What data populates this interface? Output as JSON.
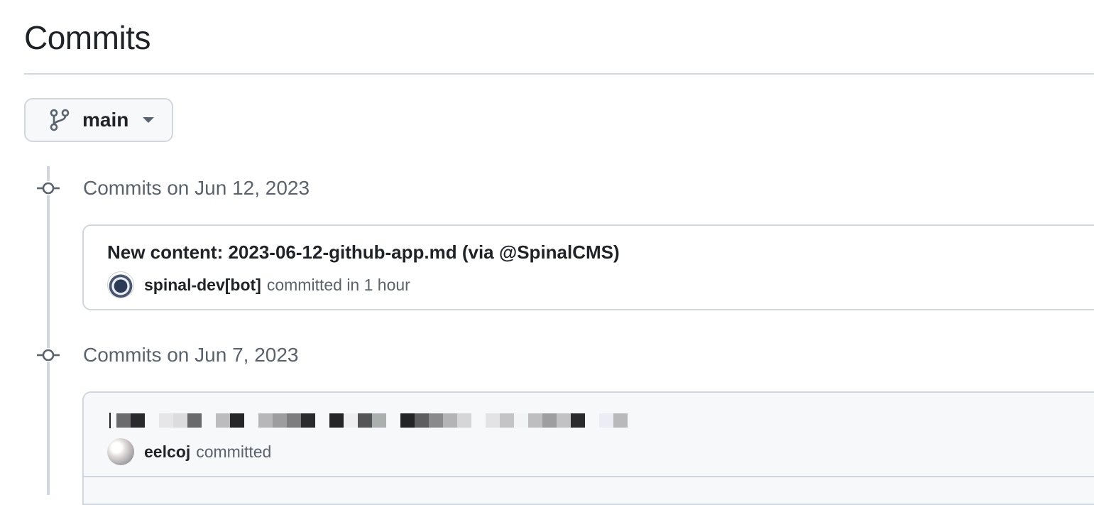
{
  "page": {
    "title": "Commits"
  },
  "branch_selector": {
    "label": "main",
    "icon": "git-branch-icon",
    "caret_icon": "triangle-down-icon"
  },
  "commit_groups": [
    {
      "heading": "Commits on Jun 12, 2023",
      "commits": [
        {
          "title": "New content: 2023-06-12-github-app.md (via @SpinalCMS)",
          "author": "spinal-dev[bot]",
          "action_text": "committed in 1 hour",
          "avatar_icon": "bot-avatar"
        }
      ]
    },
    {
      "heading": "Commits on Jun 7, 2023",
      "commits": [
        {
          "title_redacted": true,
          "author": "eelcoj",
          "action_text": "committed",
          "avatar_icon": "user-avatar"
        }
      ]
    }
  ],
  "colors": {
    "border": "#d0d7de",
    "muted_text": "#59636e",
    "primary_text": "#1f2328",
    "highlight_bg": "#f6f8fa"
  }
}
